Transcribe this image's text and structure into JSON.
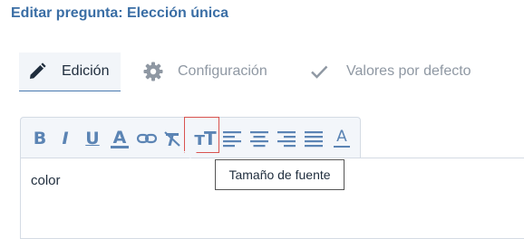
{
  "page_title": "Editar pregunta: Elección única",
  "tabs": [
    {
      "label": "Edición",
      "icon": "pencil-icon",
      "active": true
    },
    {
      "label": "Configuración",
      "icon": "gear-icon",
      "active": false
    },
    {
      "label": "Valores por defecto",
      "icon": "check-icon",
      "active": false
    }
  ],
  "toolbar": {
    "buttons": [
      {
        "name": "bold",
        "glyph": "B",
        "icon": "bold-icon"
      },
      {
        "name": "italic",
        "glyph": "I",
        "icon": "italic-icon"
      },
      {
        "name": "underline",
        "glyph": "U",
        "icon": "underline-icon"
      },
      {
        "name": "text-color",
        "glyph": "A",
        "icon": "text-color-icon"
      },
      {
        "name": "link",
        "icon": "link-icon"
      },
      {
        "name": "clear-format",
        "icon": "clear-format-icon"
      },
      {
        "name": "font-size",
        "glyph": "тT",
        "icon": "font-size-icon",
        "highlighted": true
      },
      {
        "name": "align-left",
        "icon": "align-left-icon"
      },
      {
        "name": "align-center",
        "icon": "align-center-icon"
      },
      {
        "name": "align-right",
        "icon": "align-right-icon"
      },
      {
        "name": "justify",
        "icon": "align-justify-icon"
      },
      {
        "name": "background-color",
        "glyph": "A",
        "icon": "background-color-icon"
      }
    ]
  },
  "editor": {
    "content": "color"
  },
  "tooltip": {
    "text": "Tamaño de fuente"
  },
  "colors": {
    "title": "#3a6ea5",
    "toolbar_icon": "#5b84b4",
    "highlight_border": "#d9534f",
    "inactive_tab": "#8f98a3"
  }
}
